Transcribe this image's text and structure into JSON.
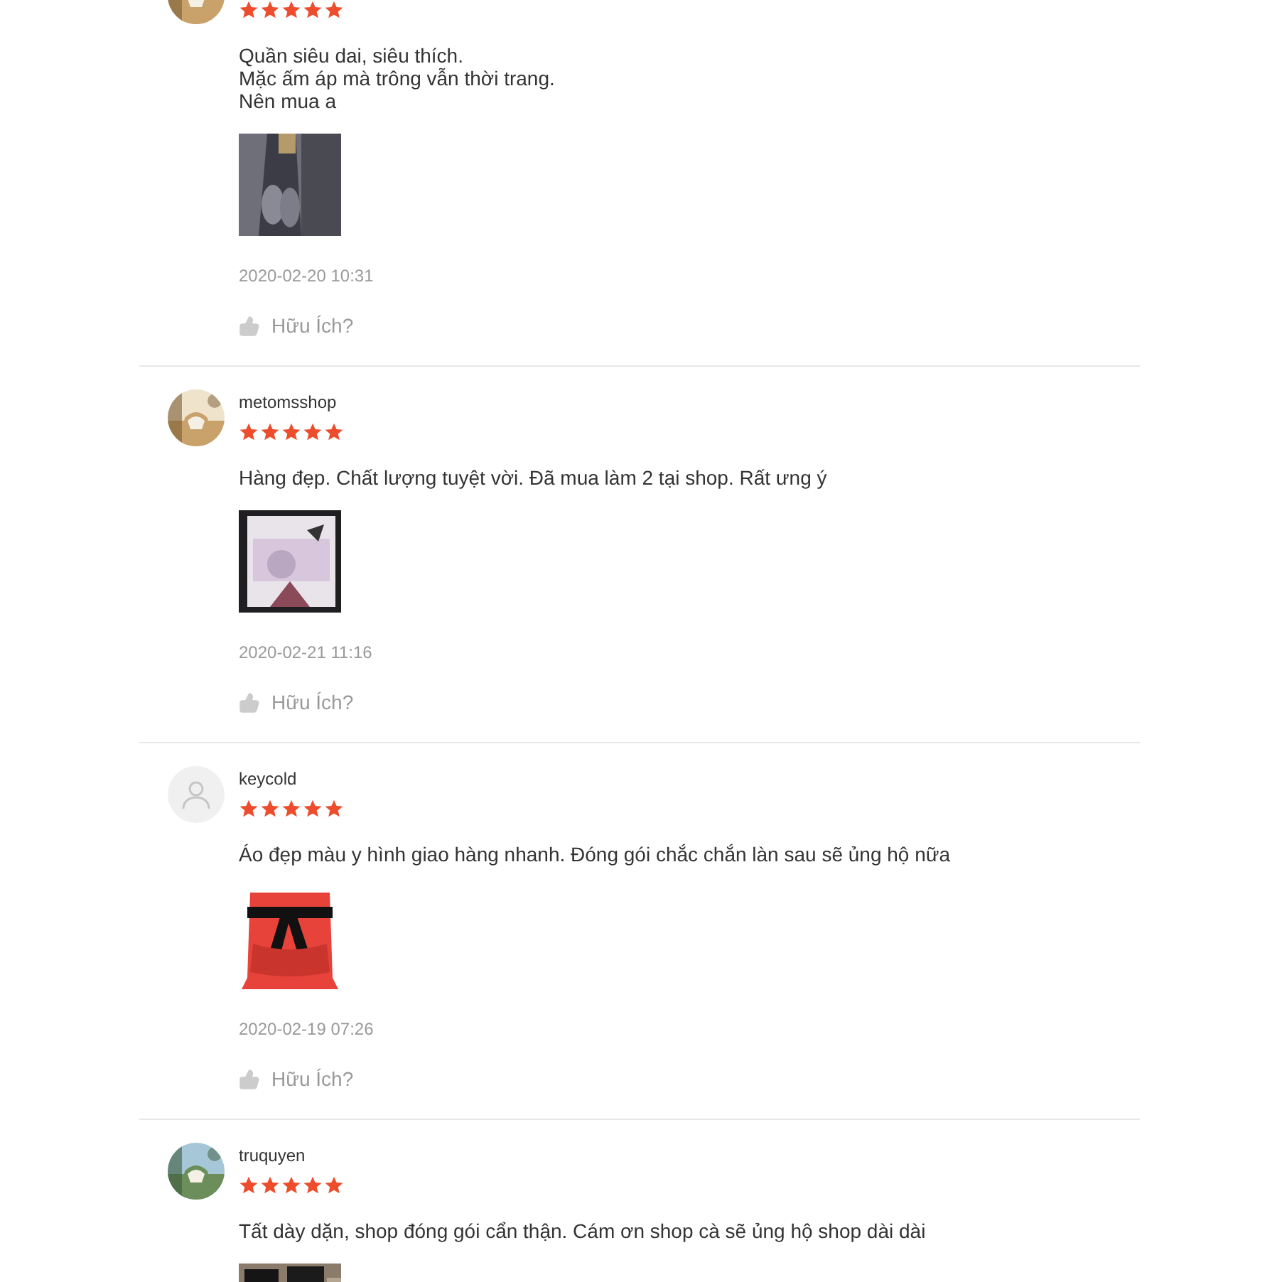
{
  "reviews": [
    {
      "avatar": {
        "kind": "picture"
      },
      "stars": 5,
      "comment_lines": [
        "Quần siêu dai, siêu thích.",
        "Mặc ấm áp mà trông vẫn thời trang.",
        "Nên mua a"
      ],
      "photo": {
        "kind": "picture"
      },
      "date": "2020-02-20 10:31",
      "helpful": "Hữu Ích?"
    },
    {
      "username": "metomsshop",
      "avatar": {
        "kind": "picture"
      },
      "stars": 5,
      "comment_lines": [
        "Hàng đẹp. Chất lượng tuyệt vời. Đã mua làm 2 tại shop. Rất ưng ý"
      ],
      "photo": {
        "kind": "picture"
      },
      "date": "2020-02-21 11:16",
      "helpful": "Hữu Ích?"
    },
    {
      "username": "keycold",
      "avatar": {
        "kind": "default"
      },
      "stars": 5,
      "comment_lines": [
        "Áo đẹp màu y hình giao hàng nhanh. Đóng gói chắc chắn làn sau sẽ ủng hộ nữa"
      ],
      "photo": {
        "kind": "picture"
      },
      "date": "2020-02-19 07:26",
      "helpful": "Hữu Ích?"
    },
    {
      "username": "truquyen",
      "avatar": {
        "kind": "picture"
      },
      "stars": 5,
      "comment_lines": [
        "Tất dày dặn, shop đóng gói cẩn thận. Cám ơn shop cà sẽ ủng hộ shop dài dài"
      ],
      "photo": {
        "kind": "picture"
      }
    }
  ]
}
